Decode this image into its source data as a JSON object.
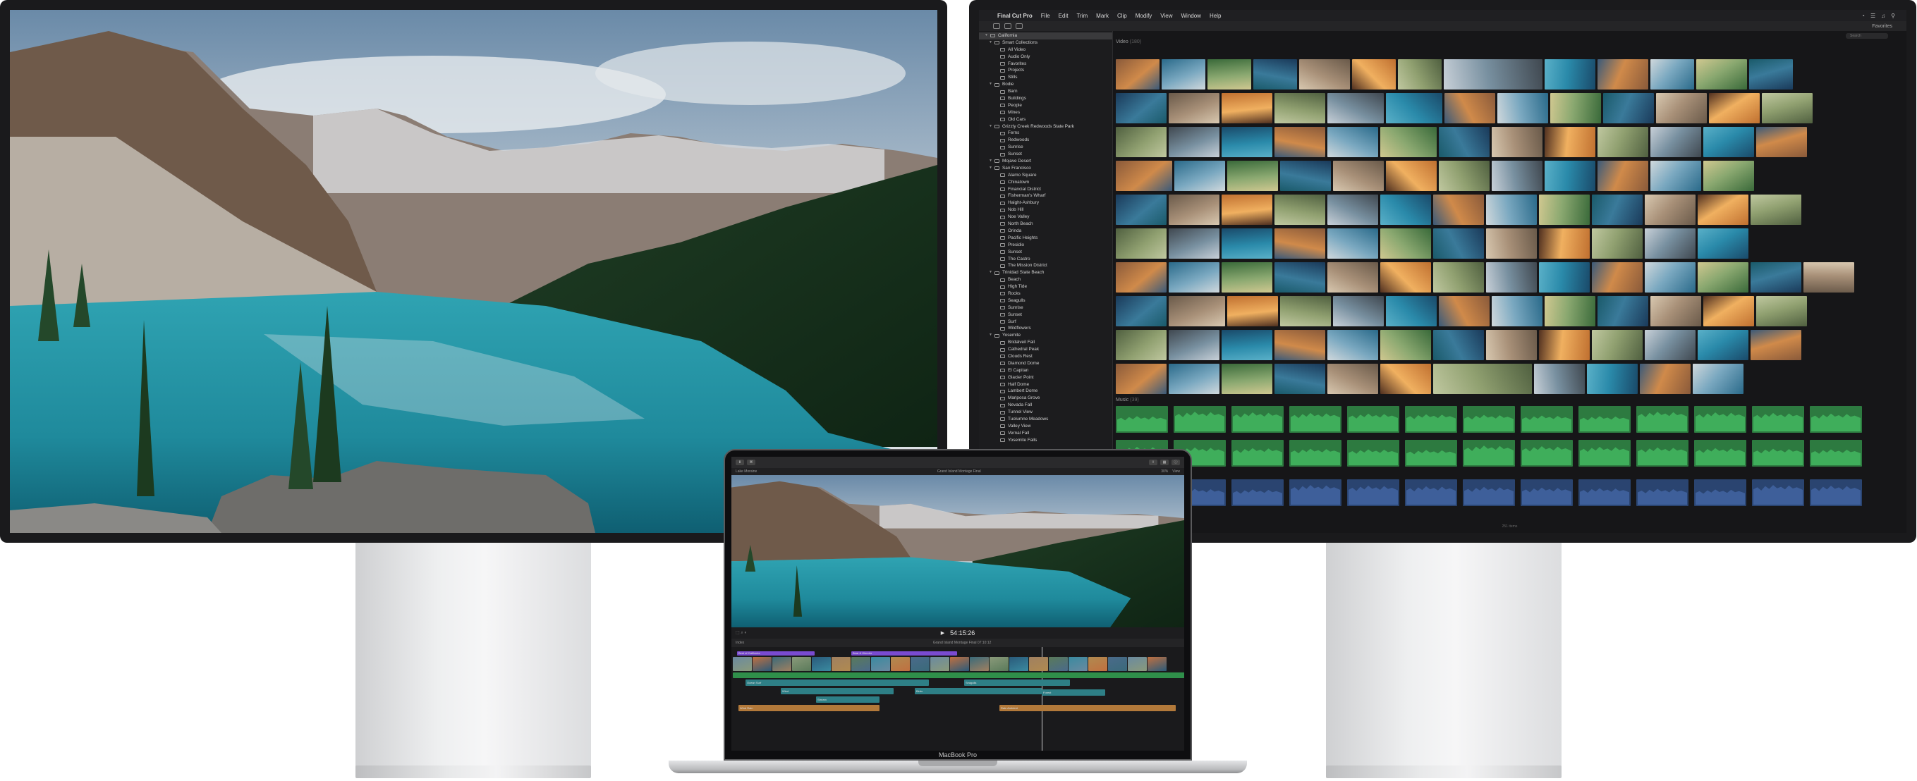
{
  "menubar": {
    "app_name": "Final Cut Pro",
    "items": [
      "File",
      "Edit",
      "Trim",
      "Mark",
      "Clip",
      "Modify",
      "View",
      "Window",
      "Help"
    ],
    "right_items": [
      "◔",
      "☰",
      "♫",
      "⚲"
    ]
  },
  "browser_toolbar": {
    "filter_label": "Favorites",
    "search_placeholder": "Search"
  },
  "sidebar": {
    "items": [
      {
        "label": "California",
        "type": "library",
        "selected": true
      },
      {
        "label": "Smart Collections",
        "type": "folder"
      },
      {
        "label": "All Video",
        "type": "smart"
      },
      {
        "label": "Audio Only",
        "type": "smart"
      },
      {
        "label": "Favorites",
        "type": "smart"
      },
      {
        "label": "Projects",
        "type": "smart"
      },
      {
        "label": "Stills",
        "type": "smart"
      },
      {
        "label": "Bodie",
        "type": "event"
      },
      {
        "label": "Barn",
        "type": "keyword"
      },
      {
        "label": "Buildings",
        "type": "keyword"
      },
      {
        "label": "People",
        "type": "keyword"
      },
      {
        "label": "Mines",
        "type": "keyword"
      },
      {
        "label": "Old Cars",
        "type": "keyword"
      },
      {
        "label": "Grizzly Creek Redwoods State Park",
        "type": "event"
      },
      {
        "label": "Ferns",
        "type": "keyword"
      },
      {
        "label": "Redwoods",
        "type": "keyword"
      },
      {
        "label": "Sunrise",
        "type": "keyword"
      },
      {
        "label": "Sunset",
        "type": "keyword"
      },
      {
        "label": "Mojave Desert",
        "type": "event"
      },
      {
        "label": "San Francisco",
        "type": "event"
      },
      {
        "label": "Alamo Square",
        "type": "keyword"
      },
      {
        "label": "Chinatown",
        "type": "keyword"
      },
      {
        "label": "Financial District",
        "type": "keyword"
      },
      {
        "label": "Fisherman's Wharf",
        "type": "keyword"
      },
      {
        "label": "Haight-Ashbury",
        "type": "keyword"
      },
      {
        "label": "Nob Hill",
        "type": "keyword"
      },
      {
        "label": "Noe Valley",
        "type": "keyword"
      },
      {
        "label": "North Beach",
        "type": "keyword"
      },
      {
        "label": "Orinda",
        "type": "keyword"
      },
      {
        "label": "Pacific Heights",
        "type": "keyword"
      },
      {
        "label": "Presidio",
        "type": "keyword"
      },
      {
        "label": "Sunset",
        "type": "keyword"
      },
      {
        "label": "The Castro",
        "type": "keyword"
      },
      {
        "label": "The Mission District",
        "type": "keyword"
      },
      {
        "label": "Trinidad State Beach",
        "type": "event"
      },
      {
        "label": "Beach",
        "type": "keyword"
      },
      {
        "label": "High Tide",
        "type": "keyword"
      },
      {
        "label": "Rocks",
        "type": "keyword"
      },
      {
        "label": "Seagulls",
        "type": "keyword"
      },
      {
        "label": "Sunrise",
        "type": "keyword"
      },
      {
        "label": "Sunset",
        "type": "keyword"
      },
      {
        "label": "Surf",
        "type": "keyword"
      },
      {
        "label": "Wildflowers",
        "type": "keyword"
      },
      {
        "label": "Yosemite",
        "type": "event"
      },
      {
        "label": "Bridalveil Fall",
        "type": "keyword"
      },
      {
        "label": "Cathedral Peak",
        "type": "keyword"
      },
      {
        "label": "Clouds Rest",
        "type": "keyword"
      },
      {
        "label": "Diamond Dome",
        "type": "keyword"
      },
      {
        "label": "El Capitan",
        "type": "keyword"
      },
      {
        "label": "Glacier Point",
        "type": "keyword"
      },
      {
        "label": "Half Dome",
        "type": "keyword"
      },
      {
        "label": "Lambert Dome",
        "type": "keyword"
      },
      {
        "label": "Mariposa Grove",
        "type": "keyword"
      },
      {
        "label": "Nevada Fall",
        "type": "keyword"
      },
      {
        "label": "Tunnel View",
        "type": "keyword"
      },
      {
        "label": "Tuolumne Meadows",
        "type": "keyword"
      },
      {
        "label": "Valley View",
        "type": "keyword"
      },
      {
        "label": "Vernal Fall",
        "type": "keyword"
      },
      {
        "label": "Yosemite Falls",
        "type": "keyword"
      }
    ]
  },
  "browser": {
    "video_section": "Video",
    "video_count": "(180)",
    "music_section": "Music",
    "music_count": "(39)",
    "footer": "251 items"
  },
  "laptop": {
    "label": "MacBook Pro",
    "library_name": "Lake Moraine",
    "project_name": "Grand Island Montage Final",
    "zoom": "30%",
    "view_label": "View",
    "timecode": "54:15:26",
    "timeline_title": "Grand Island Montage Final",
    "timeline_duration": "07:10:12",
    "tl_index_label": "Index",
    "title_clip_a": "Best of California",
    "title_clip_b": "Bear & Wonder",
    "audio_labels": [
      "Ocean Surf",
      "Seagulls",
      "Wind",
      "Birds",
      "Stream",
      "Forest",
      "Wind Rain",
      "Rain Ambient"
    ]
  },
  "colors": {
    "fcp_selection": "#3a3a3c",
    "audio_green": "#3fae5b",
    "audio_blue": "#3e5f9a",
    "title_purple": "#7a4bd1",
    "connected_teal": "#2e7f86",
    "music_orange": "#b2793a"
  }
}
